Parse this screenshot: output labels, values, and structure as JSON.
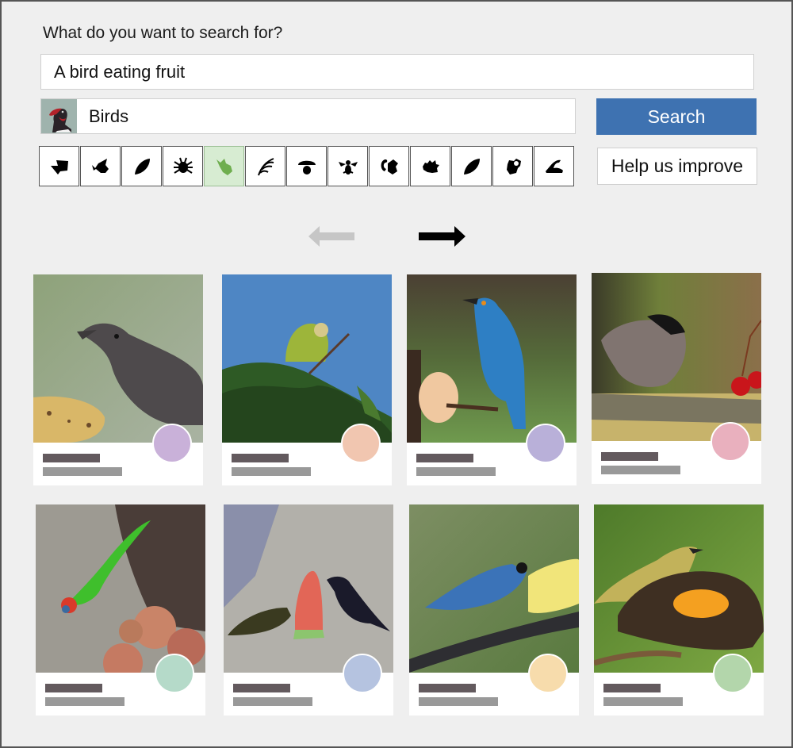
{
  "prompt": "What do you want to search for?",
  "query": {
    "value": "A bird eating fruit",
    "placeholder": ""
  },
  "category": {
    "label": "Birds",
    "thumbnail_icon": "bird-thumbnail"
  },
  "buttons": {
    "search": "Search",
    "help": "Help us improve"
  },
  "accent_color": "#3e72b1",
  "filters": [
    {
      "name": "fish",
      "icon": "fish-icon",
      "active": false
    },
    {
      "name": "bat",
      "icon": "bat-icon",
      "active": false
    },
    {
      "name": "leaf",
      "icon": "leaf-icon",
      "active": false
    },
    {
      "name": "insect",
      "icon": "bug-icon",
      "active": false
    },
    {
      "name": "bird",
      "icon": "bird-icon",
      "active": true
    },
    {
      "name": "fern",
      "icon": "fern-icon",
      "active": false
    },
    {
      "name": "mushroom",
      "icon": "mushroom-icon",
      "active": false
    },
    {
      "name": "bee",
      "icon": "bee-icon",
      "active": false
    },
    {
      "name": "squirrel",
      "icon": "squirrel-icon",
      "active": false
    },
    {
      "name": "hedgehog",
      "icon": "hedgehog-icon",
      "active": false
    },
    {
      "name": "plant",
      "icon": "plant-leaf-icon",
      "active": false
    },
    {
      "name": "flower",
      "icon": "flower-icon",
      "active": false
    },
    {
      "name": "snail",
      "icon": "snail-icon",
      "active": false
    }
  ],
  "navigation": {
    "prev_enabled": false,
    "next_enabled": true
  },
  "results": [
    {
      "subject": "grey tanager eating banana",
      "accent": "#c9b1d9"
    },
    {
      "subject": "green parakeet eating loquat in tree",
      "accent": "#f1c6b0"
    },
    {
      "subject": "blue starling on apple",
      "accent": "#b9b0d9"
    },
    {
      "subject": "chickadee near red berries",
      "accent": "#e9b0be"
    },
    {
      "subject": "green fig parrot eating figs",
      "accent": "#b5dac9"
    },
    {
      "subject": "two birds eating watermelon",
      "accent": "#b5c3e0"
    },
    {
      "subject": "blue flowerpiercer on branch with banana",
      "accent": "#f7dcac"
    },
    {
      "subject": "yellow bird eating orange",
      "accent": "#b3d6ab"
    }
  ]
}
